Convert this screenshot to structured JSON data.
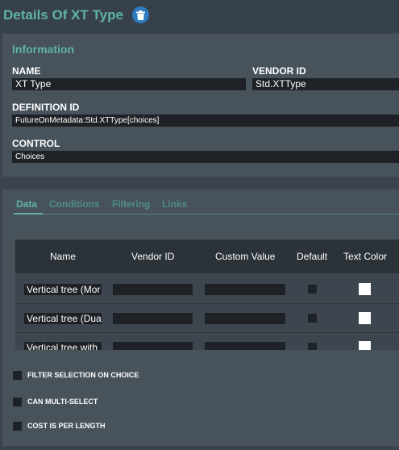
{
  "page": {
    "title": "Details Of XT Type",
    "delete_icon": "trash-icon",
    "accent": "#5fb3a4",
    "button_blue": "#2f7bc0"
  },
  "information": {
    "heading": "Information",
    "name_label": "NAME",
    "name_value": "XT Type",
    "vendor_id_label": "VENDOR ID",
    "vendor_id_value": "Std.XTType",
    "definition_id_label": "DEFINITION ID",
    "definition_id_value": "FutureOnMetadata:Std.XTType[choices]",
    "control_label": "CONTROL",
    "control_value": "Choices"
  },
  "tabs": [
    {
      "label": "Data",
      "active": true
    },
    {
      "label": "Conditions",
      "active": false
    },
    {
      "label": "Filtering",
      "active": false
    },
    {
      "label": "Links",
      "active": false
    }
  ],
  "table": {
    "headers": [
      "Name",
      "Vendor ID",
      "Custom Value",
      "Default",
      "Text Color"
    ],
    "rows": [
      {
        "name": "Vertical tree (Mor",
        "vendor_id": "",
        "custom_value": "",
        "default": false,
        "text_color": "#ffffff"
      },
      {
        "name": "Vertical tree (Dua",
        "vendor_id": "",
        "custom_value": "",
        "default": false,
        "text_color": "#ffffff"
      },
      {
        "name": "Vertical tree with",
        "vendor_id": "",
        "custom_value": "",
        "default": false,
        "text_color": "#ffffff"
      }
    ]
  },
  "options": [
    {
      "label": "FILTER SELECTION ON CHOICE",
      "checked": false
    },
    {
      "label": "CAN MULTI-SELECT",
      "checked": false
    },
    {
      "label": "COST IS PER LENGTH",
      "checked": false
    }
  ]
}
